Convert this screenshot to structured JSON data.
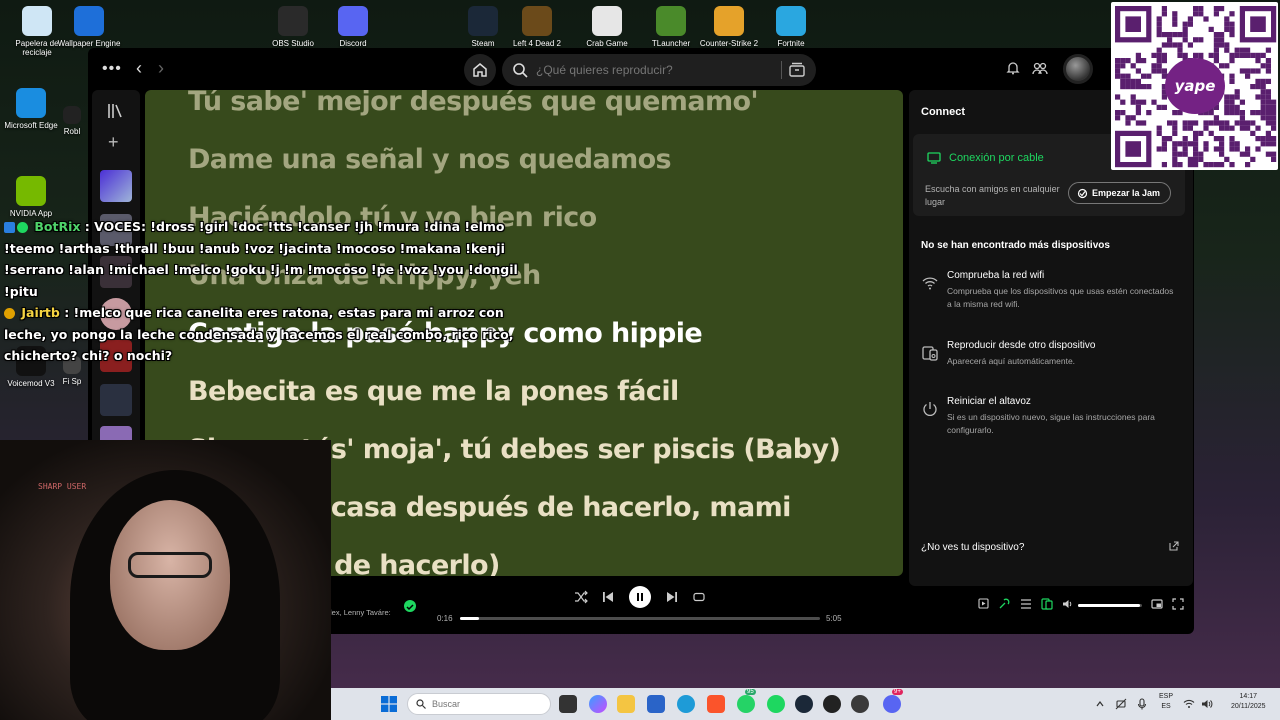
{
  "desktop": {
    "top_icons": [
      {
        "label": "Papelera de reciclaje",
        "color": "#cfe6f5"
      },
      {
        "label": "Wallpaper Engine",
        "color": "#1e6fd9"
      },
      {
        "label": "OBS Studio",
        "color": "#2a2a2a"
      },
      {
        "label": "Discord",
        "color": "#5865f2"
      },
      {
        "label": "Steam",
        "color": "#1b2838"
      },
      {
        "label": "Left 4 Dead 2",
        "color": "#6b4a1a"
      },
      {
        "label": "Crab Game",
        "color": "#e6e6e6"
      },
      {
        "label": "TLauncher",
        "color": "#4a8a2a"
      },
      {
        "label": "Counter-Strike 2",
        "color": "#e5a22a"
      },
      {
        "label": "Fortnite",
        "color": "#2aa7e0"
      }
    ],
    "left_icons": [
      {
        "label": "Microsoft Edge",
        "color": "#1a8de0"
      },
      {
        "label": "Robl",
        "color": "#222222"
      },
      {
        "label": "NVIDIA App",
        "color": "#76b900"
      },
      {
        "label": "Voicemod V3",
        "color": "#111111"
      },
      {
        "label": "Fi Sp",
        "color": "#444444"
      }
    ]
  },
  "topbar": {
    "search_placeholder": "¿Qué quieres reproducir?"
  },
  "lyrics": {
    "lines": [
      {
        "text": "Tú sabe' mejor después que quemamo'",
        "state": "past"
      },
      {
        "text": "Dame una señal y nos quedamos",
        "state": "past"
      },
      {
        "text": "Haciéndolo tú y yo bien rico",
        "state": "past"
      },
      {
        "text": "Una onza de krippy, yeh",
        "state": "past"
      },
      {
        "text": "Contigo la pasó happy como hippie",
        "state": "current"
      },
      {
        "text": "Bebecita es que me la pones fácil",
        "state": "next"
      },
      {
        "text": "Si ya estás' moja', tú debes ser piscis (Baby)",
        "state": "next"
      },
      {
        "text": "Salí de la casa después de hacerlo, mami",
        "state": "next"
      },
      {
        "text": "(Después de hacerlo)",
        "state": "next"
      }
    ]
  },
  "connect": {
    "title": "Connect",
    "wired_label": "Conexión por cable",
    "jam_text": "Escucha con amigos en cualquier lugar",
    "jam_button": "Empezar la Jam",
    "no_more_devices": "No se han encontrado más dispositivos",
    "help": [
      {
        "icon": "wifi-icon",
        "title": "Comprueba la red wifi",
        "desc": "Comprueba que los dispositivos que usas estén conectados a la misma red wifi."
      },
      {
        "icon": "device-icon",
        "title": "Reproducir desde otro dispositivo",
        "desc": "Aparecerá aquí automáticamente."
      },
      {
        "icon": "power-icon",
        "title": "Reiniciar el altavoz",
        "desc": "Si es un dispositivo nuevo, sigue las instrucciones para configurarlo."
      }
    ],
    "no_see_device": "¿No ves tu dispositivo?"
  },
  "player": {
    "artist_text": "lex, Lenny Taváre:",
    "elapsed": "0:16",
    "duration": "5:05",
    "progress_fraction": 0.053,
    "volume_fraction": 0.97
  },
  "chat": {
    "messages": [
      {
        "user": "BotRix",
        "text": ": VOCES: !dross !girl !doc !tts !canser !jh !mura !dina !elmo !teemo !arthas !thrall !buu !anub !voz !jacinta !mocoso !makana !kenji !serrano !alan !michael !melco !goku !j !m !mocoso !pe !voz !you !dongil !pitu"
      },
      {
        "user": "Jairtb",
        "text": ": !melco que rica canelita eres ratona, estas para mi arroz con leche, yo pongo la leche condensada y hacemos el real combo, rico rico, chicherto? chi? o nochi?"
      }
    ]
  },
  "webcam": {
    "sign_text": "SHARP USER"
  },
  "qr": {
    "brand": "yape"
  },
  "taskbar": {
    "search_placeholder": "Buscar",
    "whatsapp_badge": "95",
    "discord_badge": "9+",
    "language": "ESP",
    "region": "ES",
    "time": "14:17",
    "date": "20/11/2025"
  },
  "colors": {
    "spotify_green": "#1ed760",
    "lyrics_bg": "#374a1c",
    "panel_bg": "#121212"
  }
}
